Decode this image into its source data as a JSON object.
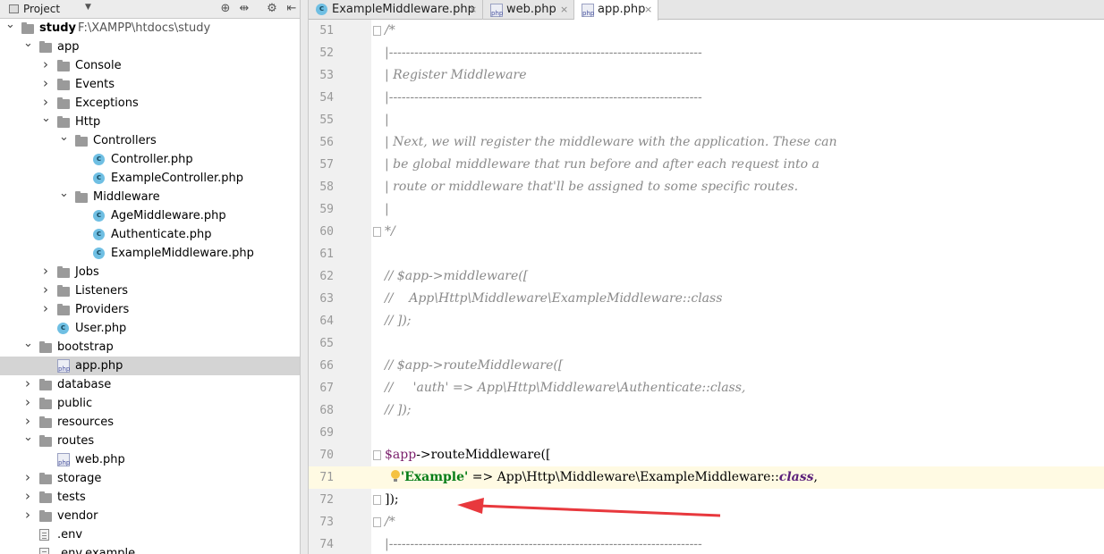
{
  "project_panel": {
    "title": "Project",
    "icons": [
      "globe-icon",
      "collapse-all-icon",
      "gear-icon",
      "hide-panel-icon"
    ],
    "tree": [
      {
        "label": "study",
        "path": "F:\\XAMPP\\htdocs\\study",
        "type": "folder",
        "depth": 0,
        "expanded": true,
        "bold": true
      },
      {
        "label": "app",
        "type": "folder",
        "depth": 1,
        "expanded": true
      },
      {
        "label": "Console",
        "type": "folder",
        "depth": 2,
        "expanded": false
      },
      {
        "label": "Events",
        "type": "folder",
        "depth": 2,
        "expanded": false
      },
      {
        "label": "Exceptions",
        "type": "folder",
        "depth": 2,
        "expanded": false
      },
      {
        "label": "Http",
        "type": "folder",
        "depth": 2,
        "expanded": true
      },
      {
        "label": "Controllers",
        "type": "folder",
        "depth": 3,
        "expanded": true
      },
      {
        "label": "Controller.php",
        "type": "class",
        "depth": 4
      },
      {
        "label": "ExampleController.php",
        "type": "class",
        "depth": 4
      },
      {
        "label": "Middleware",
        "type": "folder",
        "depth": 3,
        "expanded": true
      },
      {
        "label": "AgeMiddleware.php",
        "type": "class",
        "depth": 4
      },
      {
        "label": "Authenticate.php",
        "type": "class",
        "depth": 4
      },
      {
        "label": "ExampleMiddleware.php",
        "type": "class",
        "depth": 4
      },
      {
        "label": "Jobs",
        "type": "folder",
        "depth": 2,
        "expanded": false
      },
      {
        "label": "Listeners",
        "type": "folder",
        "depth": 2,
        "expanded": false
      },
      {
        "label": "Providers",
        "type": "folder",
        "depth": 2,
        "expanded": false
      },
      {
        "label": "User.php",
        "type": "class",
        "depth": 2
      },
      {
        "label": "bootstrap",
        "type": "folder",
        "depth": 1,
        "expanded": true
      },
      {
        "label": "app.php",
        "type": "php",
        "depth": 2,
        "selected": true
      },
      {
        "label": "database",
        "type": "folder",
        "depth": 1,
        "expanded": false
      },
      {
        "label": "public",
        "type": "folder",
        "depth": 1,
        "expanded": false
      },
      {
        "label": "resources",
        "type": "folder",
        "depth": 1,
        "expanded": false
      },
      {
        "label": "routes",
        "type": "folder",
        "depth": 1,
        "expanded": true
      },
      {
        "label": "web.php",
        "type": "php",
        "depth": 2
      },
      {
        "label": "storage",
        "type": "folder",
        "depth": 1,
        "expanded": false
      },
      {
        "label": "tests",
        "type": "folder",
        "depth": 1,
        "expanded": false
      },
      {
        "label": "vendor",
        "type": "folder",
        "depth": 1,
        "expanded": false
      },
      {
        "label": ".env",
        "type": "file",
        "depth": 1
      },
      {
        "label": ".env.example",
        "type": "file",
        "depth": 1
      }
    ]
  },
  "editor": {
    "tabs": [
      {
        "label": "ExampleMiddleware.php",
        "icon": "class",
        "active": false
      },
      {
        "label": "web.php",
        "icon": "php",
        "active": false
      },
      {
        "label": "app.php",
        "icon": "php",
        "active": true
      }
    ],
    "close_glyph": "×",
    "lines": [
      {
        "n": "51",
        "fold": true,
        "segs": [
          {
            "t": "/*",
            "c": "cm"
          }
        ]
      },
      {
        "n": "52",
        "segs": [
          {
            "t": "|--------------------------------------------------------------------------",
            "c": "cm"
          }
        ]
      },
      {
        "n": "53",
        "segs": [
          {
            "t": "| Register Middleware",
            "c": "cm"
          }
        ]
      },
      {
        "n": "54",
        "segs": [
          {
            "t": "|--------------------------------------------------------------------------",
            "c": "cm"
          }
        ]
      },
      {
        "n": "55",
        "segs": [
          {
            "t": "|",
            "c": "cm"
          }
        ]
      },
      {
        "n": "56",
        "segs": [
          {
            "t": "| Next, we will register the middleware with the application. These can",
            "c": "cm"
          }
        ]
      },
      {
        "n": "57",
        "segs": [
          {
            "t": "| be global middleware that run before and after each request into a",
            "c": "cm"
          }
        ]
      },
      {
        "n": "58",
        "segs": [
          {
            "t": "| route or middleware that'll be assigned to some specific routes.",
            "c": "cm"
          }
        ]
      },
      {
        "n": "59",
        "segs": [
          {
            "t": "|",
            "c": "cm"
          }
        ]
      },
      {
        "n": "60",
        "fold": true,
        "segs": [
          {
            "t": "*/",
            "c": "cm"
          }
        ]
      },
      {
        "n": "61",
        "segs": []
      },
      {
        "n": "62",
        "segs": [
          {
            "t": "// $app->middleware([",
            "c": "cm"
          }
        ]
      },
      {
        "n": "63",
        "segs": [
          {
            "t": "//    App\\Http\\Middleware\\ExampleMiddleware::class",
            "c": "cm"
          }
        ]
      },
      {
        "n": "64",
        "segs": [
          {
            "t": "// ]);",
            "c": "cm"
          }
        ]
      },
      {
        "n": "65",
        "segs": []
      },
      {
        "n": "66",
        "segs": [
          {
            "t": "// $app->routeMiddleware([",
            "c": "cm"
          }
        ]
      },
      {
        "n": "67",
        "segs": [
          {
            "t": "//     'auth' => App\\Http\\Middleware\\Authenticate::class,",
            "c": "cm"
          }
        ]
      },
      {
        "n": "68",
        "segs": [
          {
            "t": "// ]);",
            "c": "cm"
          }
        ]
      },
      {
        "n": "69",
        "segs": []
      },
      {
        "n": "70",
        "fold": true,
        "segs": [
          {
            "t": "$app",
            "c": "var"
          },
          {
            "t": "->routeMiddleware([",
            "c": ""
          }
        ]
      },
      {
        "n": "71",
        "current": true,
        "bulb": true,
        "segs": [
          {
            "t": "    ",
            "c": ""
          },
          {
            "t": "'Example'",
            "c": "str"
          },
          {
            "t": " => App\\Http\\Middleware\\ExampleMiddleware::",
            "c": ""
          },
          {
            "t": "class",
            "c": "kw"
          },
          {
            "t": ",",
            "c": ""
          }
        ]
      },
      {
        "n": "72",
        "fold": true,
        "segs": [
          {
            "t": "]);",
            "c": ""
          }
        ]
      },
      {
        "n": "73",
        "fold": true,
        "segs": [
          {
            "t": "/*",
            "c": "cm"
          }
        ]
      },
      {
        "n": "74",
        "segs": [
          {
            "t": "|--------------------------------------------------------------------------",
            "c": "cm"
          }
        ]
      }
    ]
  },
  "colors": {
    "annotation_arrow": "#e8383d",
    "current_line": "#fffae3",
    "selection": "#d4d4d4"
  }
}
